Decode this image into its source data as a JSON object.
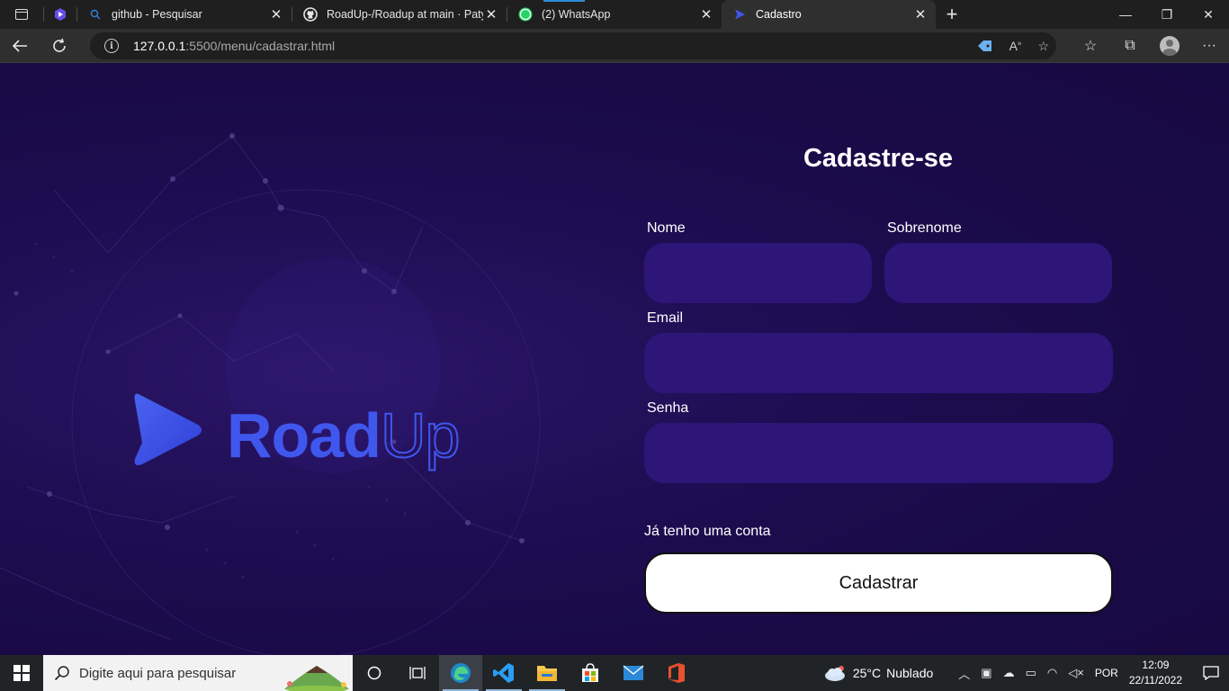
{
  "browser": {
    "tabs": [
      {
        "title": "github - Pesquisar",
        "icon": "search-icon",
        "active": false
      },
      {
        "title": "RoadUp-/Roadup at main · Patyh",
        "icon": "github-icon",
        "active": false
      },
      {
        "title": "(2) WhatsApp",
        "icon": "whatsapp-icon",
        "badge": "2",
        "active": false
      },
      {
        "title": "Cadastro",
        "icon": "roadup-icon",
        "active": true
      }
    ],
    "address": {
      "host": "127.0.0.1",
      "path": ":5500/menu/cadastrar.html"
    }
  },
  "page": {
    "logo": {
      "word1": "Road",
      "word2": "Up"
    },
    "form": {
      "title": "Cadastre-se",
      "first_name_label": "Nome",
      "last_name_label": "Sobrenome",
      "email_label": "Email",
      "password_label": "Senha",
      "first_name_value": "",
      "last_name_value": "",
      "email_value": "",
      "password_value": "",
      "have_account": "Já tenho uma conta",
      "submit_label": "Cadastrar"
    }
  },
  "taskbar": {
    "search_placeholder": "Digite aqui para pesquisar",
    "weather": {
      "temp": "25°C",
      "condition": "Nublado"
    },
    "language": "POR",
    "time": "12:09",
    "date": "22/11/2022"
  },
  "colors": {
    "page_bg": "#1a0b45",
    "input_bg": "#2d1677",
    "brand_blue": "#4057ee"
  }
}
